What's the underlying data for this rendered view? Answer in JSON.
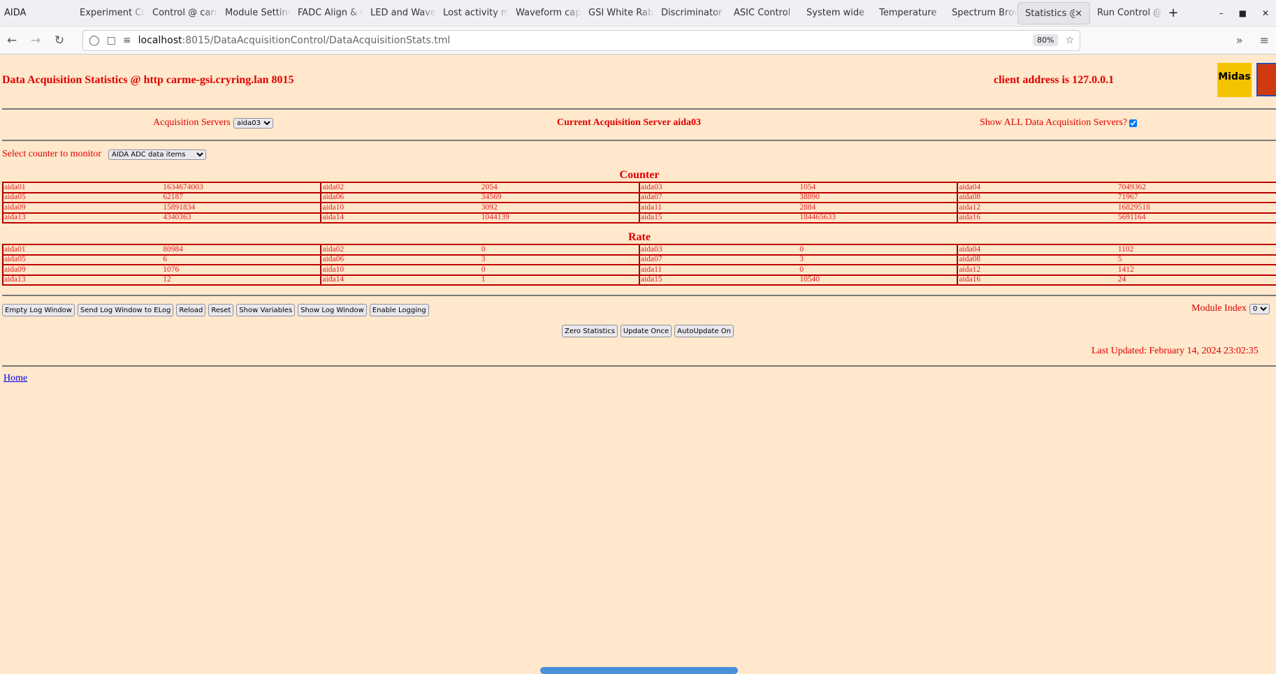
{
  "browser": {
    "window_title": "AIDA",
    "tabs": [
      "Experiment Control",
      "Control @ carme",
      "Module Settings",
      "FADC Align & Control",
      "LED and Waveform",
      "Lost activity monitor",
      "Waveform capture",
      "GSI White Rabbit",
      "Discriminator",
      "ASIC Control",
      "System wide",
      "Temperature",
      "Spectrum Browser",
      "Statistics @",
      "Run Control @"
    ],
    "active_tab_index": 13,
    "url_host": "localhost",
    "url_path": ":8015/DataAcquisitionControl/DataAcquisitionStats.tml",
    "zoom": "80%"
  },
  "page": {
    "title": "Data Acquisition Statistics @ http carme-gsi.cryring.lan 8015",
    "client": "client address is 127.0.0.1",
    "logo_text": "Midas",
    "acq_servers_label": "Acquisition Servers",
    "acq_server_selected": "aida03",
    "current_server": "Current Acquisition Server aida03",
    "show_all_label": "Show ALL Data Acquisition Servers?",
    "show_all_checked": true,
    "counter_label": "Select counter to monitor",
    "counter_selected": "AIDA ADC data items",
    "counter_heading": "Counter",
    "rate_heading": "Rate",
    "counter": [
      [
        "aida01",
        "1634674003",
        "aida02",
        "2054",
        "aida03",
        "1054",
        "aida04",
        "7049362"
      ],
      [
        "aida05",
        "62187",
        "aida06",
        "34569",
        "aida07",
        "38890",
        "aida08",
        "71967"
      ],
      [
        "aida09",
        "15891834",
        "aida10",
        "3092",
        "aida11",
        "2884",
        "aida12",
        "16829518"
      ],
      [
        "aida13",
        "4340363",
        "aida14",
        "1044139",
        "aida15",
        "184465633",
        "aida16",
        "5691164"
      ]
    ],
    "rate": [
      [
        "aida01",
        "80984",
        "aida02",
        "0",
        "aida03",
        "0",
        "aida04",
        "1102"
      ],
      [
        "aida05",
        "6",
        "aida06",
        "3",
        "aida07",
        "3",
        "aida08",
        "5"
      ],
      [
        "aida09",
        "1076",
        "aida10",
        "0",
        "aida11",
        "0",
        "aida12",
        "1412"
      ],
      [
        "aida13",
        "12",
        "aida14",
        "1",
        "aida15",
        "10540",
        "aida16",
        "24"
      ]
    ],
    "buttons": [
      "Empty Log Window",
      "Send Log Window to ELog",
      "Reload",
      "Reset",
      "Show Variables",
      "Show Log Window",
      "Enable Logging"
    ],
    "module_index_label": "Module Index",
    "module_index_value": "0",
    "buttons2": [
      "Zero Statistics",
      "Update Once",
      "AutoUpdate On"
    ],
    "last_updated": "Last Updated: February 14, 2024 23:02:35",
    "home_link": "Home"
  }
}
